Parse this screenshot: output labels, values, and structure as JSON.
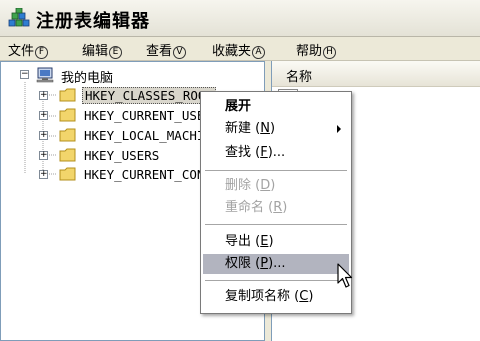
{
  "window": {
    "title": "注册表编辑器"
  },
  "menubar": [
    {
      "label": "文件",
      "accel": "F"
    },
    {
      "label": "编辑",
      "accel": "E"
    },
    {
      "label": "查看",
      "accel": "V"
    },
    {
      "label": "收藏夹",
      "accel": "A"
    },
    {
      "label": "帮助",
      "accel": "H"
    }
  ],
  "tree": {
    "root": "我的电脑",
    "keys": [
      "HKEY_CLASSES_ROOT",
      "HKEY_CURRENT_USE",
      "HKEY_LOCAL_MACHI",
      "HKEY_USERS",
      "HKEY_CURRENT_CON"
    ]
  },
  "list": {
    "header_name": "名称"
  },
  "context_menu": {
    "expand": "展开",
    "new": "新建",
    "new_accel": "N",
    "find": "查找",
    "find_accel": "F",
    "find_ellipsis": "...",
    "delete": "删除",
    "delete_accel": "D",
    "rename": "重命名",
    "rename_accel": "R",
    "export": "导出",
    "export_accel": "E",
    "permissions": "权限",
    "permissions_accel": "P",
    "permissions_ellipsis": "...",
    "copy_key_name": "复制项名称",
    "copy_accel": "C"
  },
  "colors": {
    "window_bg": "#ece9d8",
    "highlight": "#b2b4bf",
    "disabled_text": "#a3a3a3",
    "folder": "#f2d56b"
  }
}
